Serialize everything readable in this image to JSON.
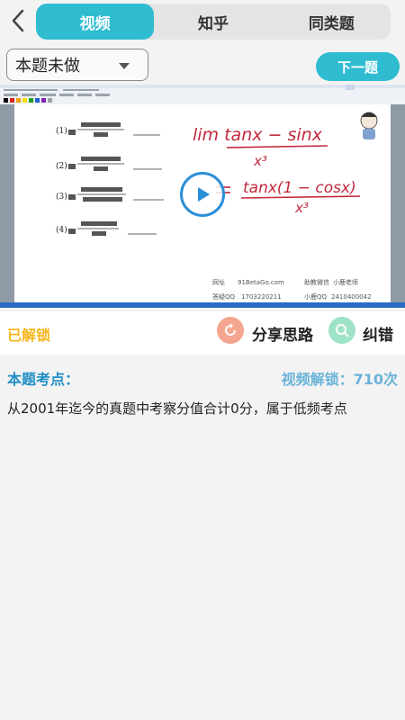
{
  "nav": {
    "back_icon": "chevron-left-icon",
    "tabs": [
      {
        "label": "视频",
        "active": true
      },
      {
        "label": "知乎",
        "active": false
      },
      {
        "label": "同类题",
        "active": false
      }
    ]
  },
  "filter": {
    "selected": "本题未做",
    "next_label": "下一题"
  },
  "video": {
    "problems": [
      "(1)",
      "(2)",
      "(3)",
      "(4)"
    ],
    "handwriting_1": "lim  tanx − sinx",
    "handwriting_1_denom": "x³",
    "handwriting_2": "tanx(1 − cosx)",
    "handwriting_2_denom": "x³",
    "watermark": [
      "网址",
      "91BetaGo.com",
      "助教微信",
      "小鹿老师",
      "答疑QQ",
      "1703220211",
      "小鹿QQ",
      "2410400042"
    ]
  },
  "actions": {
    "status": "已解锁",
    "share_label": "分享思路",
    "fix_label": "纠错"
  },
  "knowledge": {
    "title": "本题考点：",
    "unlock_count": "视频解锁：710次",
    "description": "从2001年迄今的真题中考察分值合计0分，属于低频考点"
  },
  "colors": {
    "accent": "#2fbcd0",
    "unlocked": "#f5b51c",
    "kp_title": "#1e8fc4",
    "kp_count": "#6ab3d9"
  }
}
